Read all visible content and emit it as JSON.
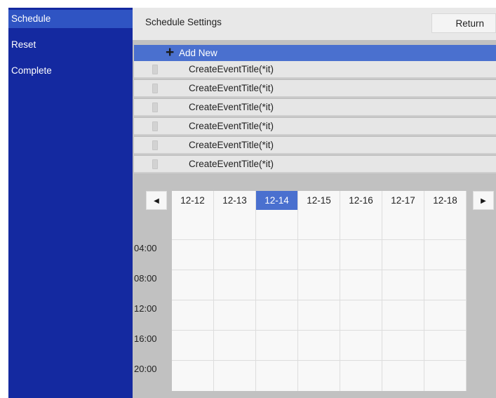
{
  "sidebar": {
    "items": [
      {
        "label": "Schedule",
        "active": true
      },
      {
        "label": "Reset",
        "active": false
      },
      {
        "label": "Complete",
        "active": false
      }
    ]
  },
  "header": {
    "title": "Schedule Settings",
    "return_label": "Return"
  },
  "event_list": {
    "add_icon": "plus-icon",
    "add_label": "Add New",
    "events": [
      {
        "title": "CreateEventTitle(*it)"
      },
      {
        "title": "CreateEventTitle(*it)"
      },
      {
        "title": "CreateEventTitle(*it)"
      },
      {
        "title": "CreateEventTitle(*it)"
      },
      {
        "title": "CreateEventTitle(*it)"
      },
      {
        "title": "CreateEventTitle(*it)"
      }
    ]
  },
  "calendar": {
    "prev_icon": "triangle-left-icon",
    "next_icon": "triangle-right-icon",
    "dates": [
      "12-12",
      "12-13",
      "12-14",
      "12-15",
      "12-16",
      "12-17",
      "12-18"
    ],
    "selected_date": "12-14",
    "time_labels": [
      "04:00",
      "08:00",
      "12:00",
      "16:00",
      "20:00"
    ]
  },
  "colors": {
    "sidebar_bg": "#1429a0",
    "sidebar_active": "#2f54c3",
    "accent": "#4a70cf",
    "panel_bg": "#c1c1c1",
    "row_bg": "#e6e6e6"
  }
}
